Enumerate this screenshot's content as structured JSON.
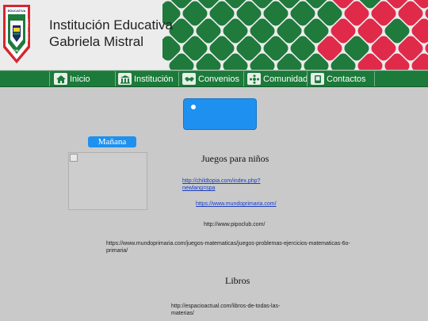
{
  "header": {
    "title_line1": "Institución Educativa",
    "title_line2": "Gabriela Mistral",
    "logo": {
      "top_text": "EDUCATIVA",
      "side_text": "GABRIELA MISTRAL",
      "bottom_text": "CALI",
      "colors": {
        "red": "#d6262e",
        "green": "#1f7a3c",
        "navy": "#1d2a6b"
      }
    },
    "tile_colors": {
      "green": "#1f7a3c",
      "red": "#e02a4a"
    }
  },
  "nav": {
    "bar_color": "#1c7a3a",
    "items": [
      {
        "label": "Inicio",
        "icon": "home-icon"
      },
      {
        "label": "Institución",
        "icon": "building-icon"
      },
      {
        "label": "Convenios",
        "icon": "handshake-icon"
      },
      {
        "label": "Comunidad",
        "icon": "community-icon"
      },
      {
        "label": "Contactos",
        "icon": "phone-icon"
      }
    ]
  },
  "content": {
    "shift_badge": "Mañana",
    "accent_blue": "#1e90f0",
    "games_heading": "Juegos para niños",
    "links": [
      "http://childtopia.com/index.php?newlang=spa",
      "https://www.mundoprimaria.com/",
      "http://www.pipoclub.com/",
      "https://www.mundoprimaria.com/juegos-matematicas/juegos-problemas-ejercicios-matematicas-6o-primaria/"
    ],
    "books_heading": "Libros",
    "books_link": "http://espacioactual.com/libros-de-todas-las-materias/"
  }
}
